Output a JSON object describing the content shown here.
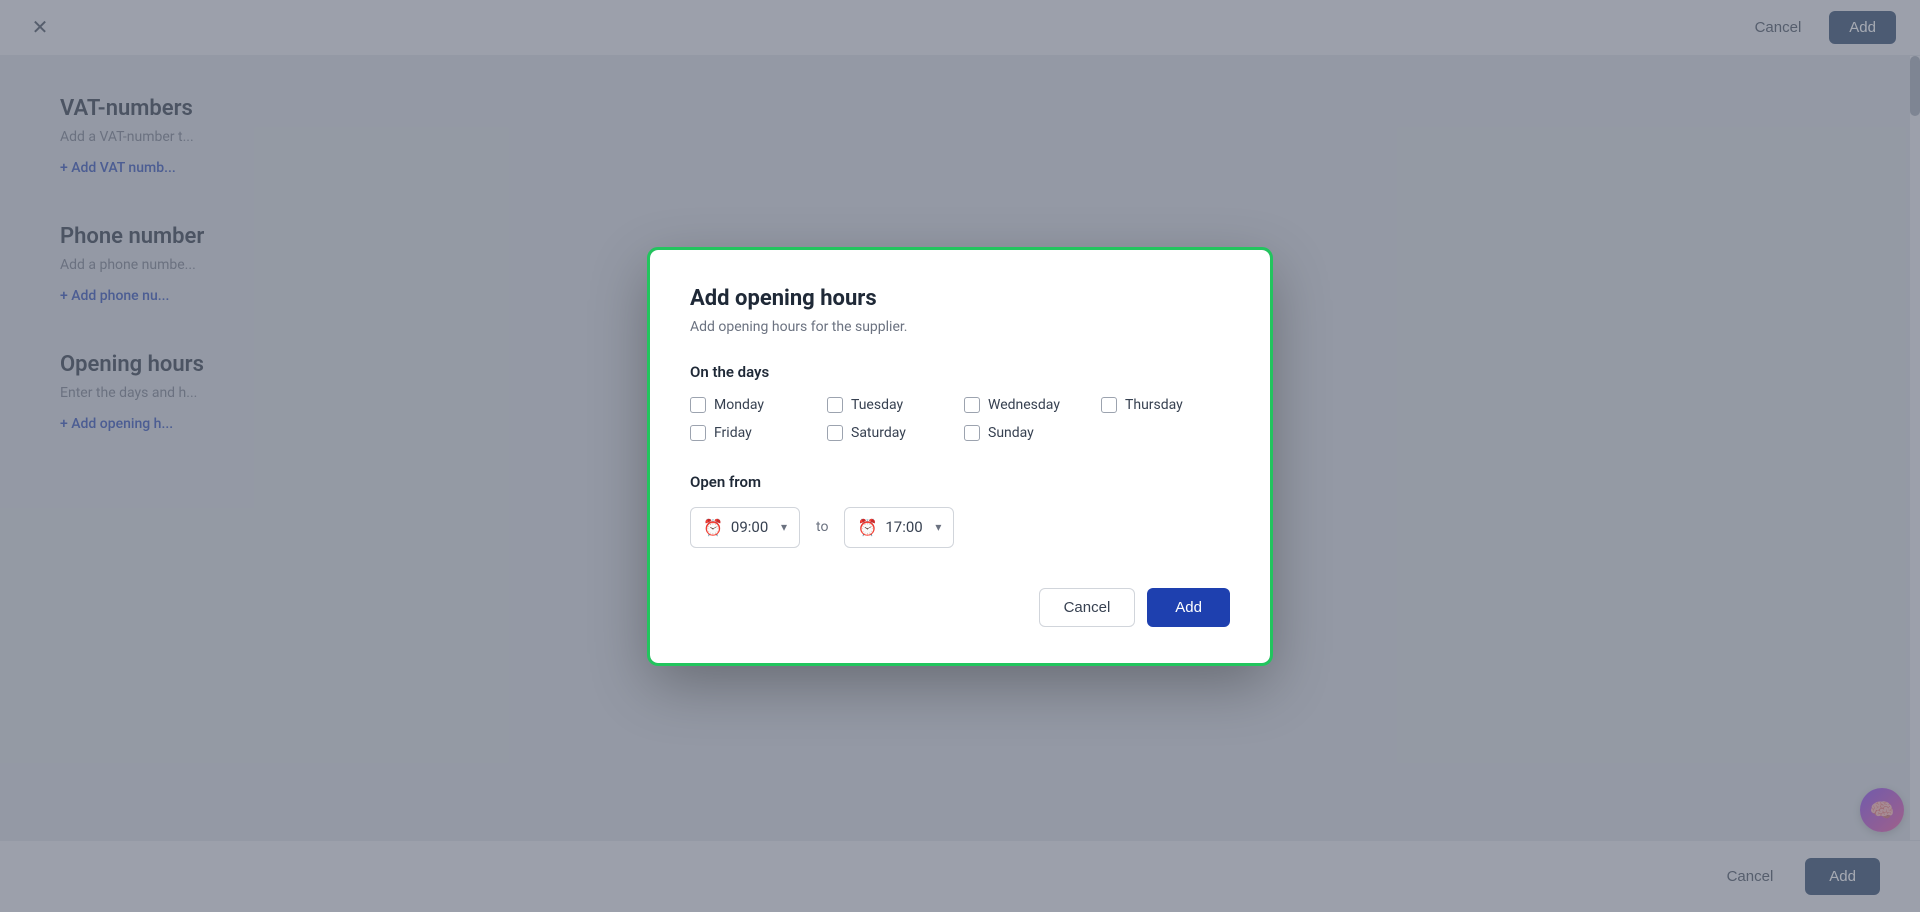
{
  "topBar": {
    "cancelLabel": "Cancel",
    "addLabel": "Add"
  },
  "background": {
    "sections": [
      {
        "title": "VAT-numbers",
        "description": "Add a VAT-number t...",
        "linkText": "+ Add VAT numb..."
      },
      {
        "title": "Phone number",
        "description": "Add a phone numbe...",
        "linkText": "+ Add phone nu..."
      },
      {
        "title": "Opening hours",
        "description": "Enter the days and h...",
        "linkText": "+ Add opening h..."
      }
    ]
  },
  "bottomBar": {
    "cancelLabel": "Cancel",
    "addLabel": "Add"
  },
  "modal": {
    "title": "Add opening hours",
    "subtitle": "Add opening hours for the supplier.",
    "onTheDaysLabel": "On the days",
    "days": [
      {
        "id": "monday",
        "label": "Monday",
        "checked": false
      },
      {
        "id": "tuesday",
        "label": "Tuesday",
        "checked": false
      },
      {
        "id": "wednesday",
        "label": "Wednesday",
        "checked": false
      },
      {
        "id": "thursday",
        "label": "Thursday",
        "checked": false
      },
      {
        "id": "friday",
        "label": "Friday",
        "checked": false
      },
      {
        "id": "saturday",
        "label": "Saturday",
        "checked": false
      },
      {
        "id": "sunday",
        "label": "Sunday",
        "checked": false
      }
    ],
    "openFromLabel": "Open from",
    "startTime": "09:00",
    "toLabel": "to",
    "endTime": "17:00",
    "cancelLabel": "Cancel",
    "addLabel": "Add"
  }
}
